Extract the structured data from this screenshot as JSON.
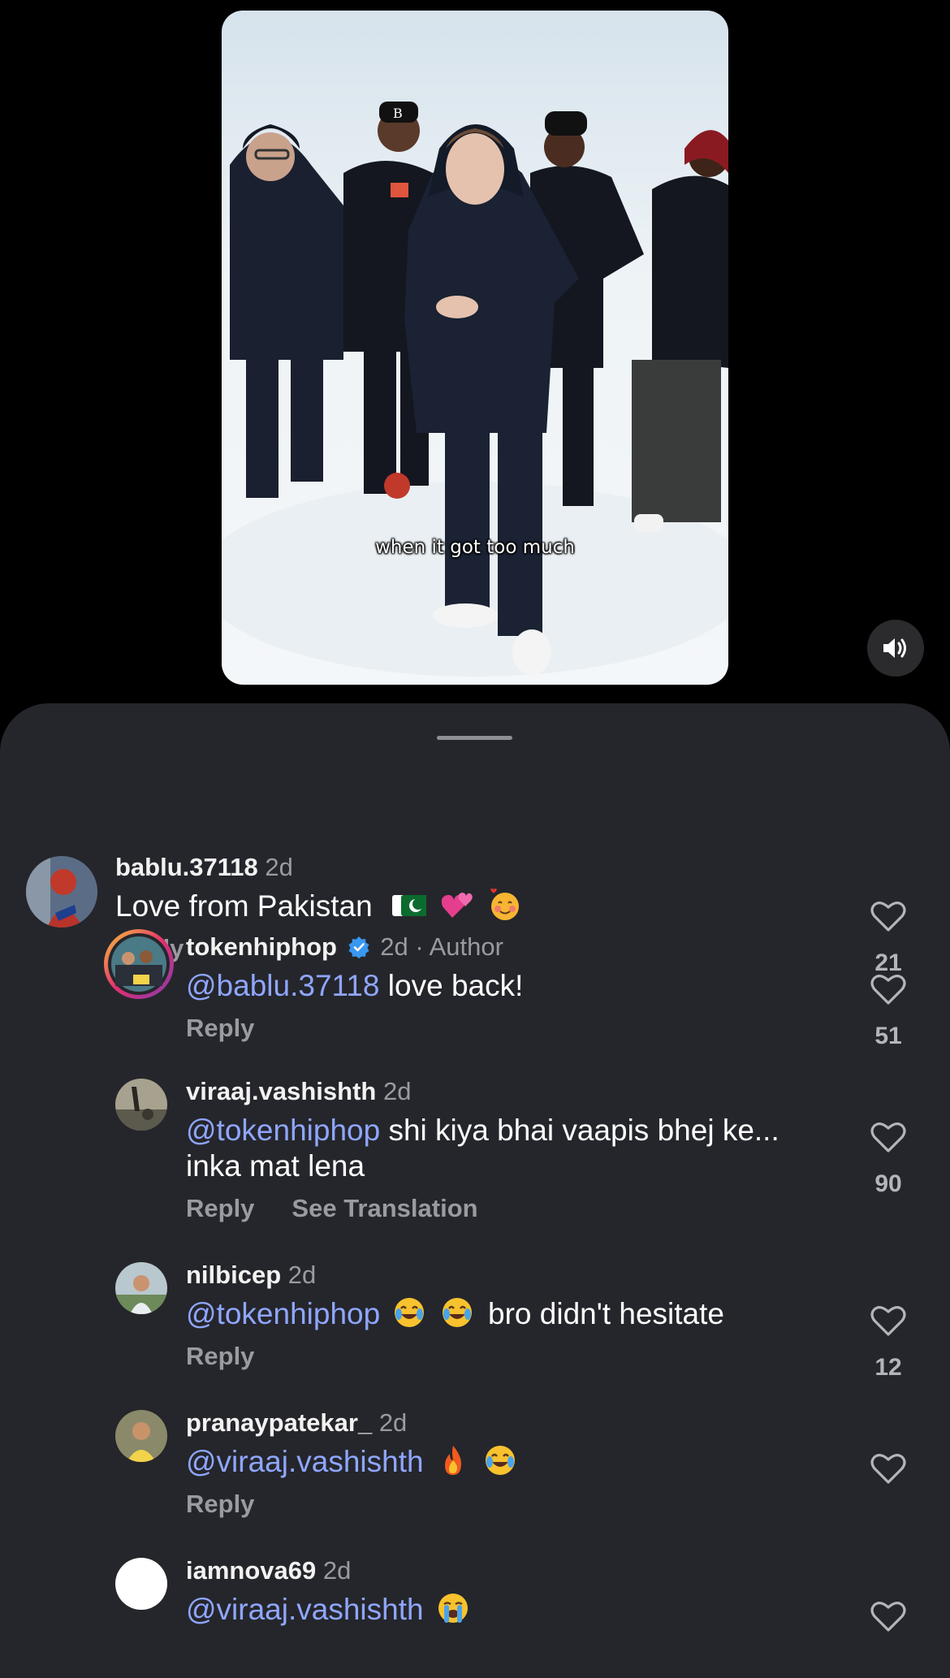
{
  "video": {
    "caption": "when it got too much"
  },
  "comments": [
    {
      "username": "bablu.37118",
      "time": "2d",
      "author_tag": "",
      "mention": "",
      "text": "Love from Pakistan",
      "emojis": [
        "pakistan-flag",
        "two-hearts",
        "smiling-face-with-hearts"
      ],
      "actions": [
        "Reply"
      ],
      "likes": "21"
    },
    {
      "username": "tokenhiphop",
      "time": "2d",
      "author_tag": "· Author",
      "mention": "@bablu.37118",
      "text": "love back!",
      "emojis": [],
      "actions": [
        "Reply"
      ],
      "likes": "51"
    },
    {
      "username": "viraaj.vashishth",
      "time": "2d",
      "author_tag": "",
      "mention": "@tokenhiphop",
      "text": "shi kiya bhai vaapis bhej ke... inka mat lena",
      "emojis": [],
      "actions": [
        "Reply",
        "See Translation"
      ],
      "likes": "90"
    },
    {
      "username": "nilbicep",
      "time": "2d",
      "author_tag": "",
      "mention": "@tokenhiphop",
      "text": "bro didn't hesitate",
      "emojis": [
        "joy",
        "joy"
      ],
      "actions": [
        "Reply"
      ],
      "likes": "12"
    },
    {
      "username": "pranaypatekar_",
      "time": "2d",
      "author_tag": "",
      "mention": "@viraaj.vashishth",
      "text": "",
      "emojis": [
        "fire",
        "joy"
      ],
      "actions": [
        "Reply"
      ],
      "likes": ""
    },
    {
      "username": "iamnova69",
      "time": "2d",
      "author_tag": "",
      "mention": "@viraaj.vashishth",
      "text": "",
      "emojis": [
        "loudly-crying"
      ],
      "actions": [],
      "likes": ""
    }
  ],
  "colors": {
    "sheet_bg": "#25262b",
    "mention": "#8fa6ff",
    "verified": "#3897f0",
    "muted_text": "#9a9ba0"
  }
}
